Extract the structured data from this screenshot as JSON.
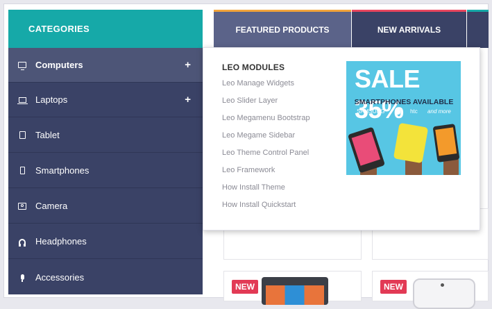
{
  "sidebar": {
    "title": "CATEGORIES",
    "items": [
      {
        "label": "Computers",
        "icon": "monitor-icon",
        "expand": "+"
      },
      {
        "label": "Laptops",
        "icon": "laptop-icon",
        "expand": "+"
      },
      {
        "label": "Tablet",
        "icon": "tablet-icon"
      },
      {
        "label": "Smartphones",
        "icon": "smartphone-icon"
      },
      {
        "label": "Camera",
        "icon": "camera-icon"
      },
      {
        "label": "Headphones",
        "icon": "headphones-icon"
      },
      {
        "label": "Accessories",
        "icon": "microphone-icon"
      }
    ]
  },
  "tabs": {
    "featured": "FEATURED PRODUCTS",
    "new_arrivals": "NEW ARRIVALS"
  },
  "products": {
    "rating_stars": "★★★★★",
    "badge": "NEW"
  },
  "mega_menu": {
    "title": "LEO MODULES",
    "links": [
      "Leo Manage Widgets",
      "Leo Slider Layer",
      "Leo Megamenu Bootstrap",
      "Leo Megame Sidebar",
      "Leo Theme Control Panel",
      "Leo Framework",
      "How Install Theme",
      "How Install Quickstart"
    ],
    "ad": {
      "headline": "SALE 35%",
      "subline": "SMARTPHONES AVAILABLE",
      "brands": [
        "SAMSUNG",
        "",
        "htc",
        "and more"
      ]
    }
  },
  "colors": {
    "teal": "#16a9a8",
    "navy": "#3a4266",
    "active_item": "#4d5577",
    "orange_accent": "#f2a33a",
    "red_accent": "#e8465e",
    "badge_red": "#e23a55",
    "ad_blue": "#57c6e4"
  }
}
